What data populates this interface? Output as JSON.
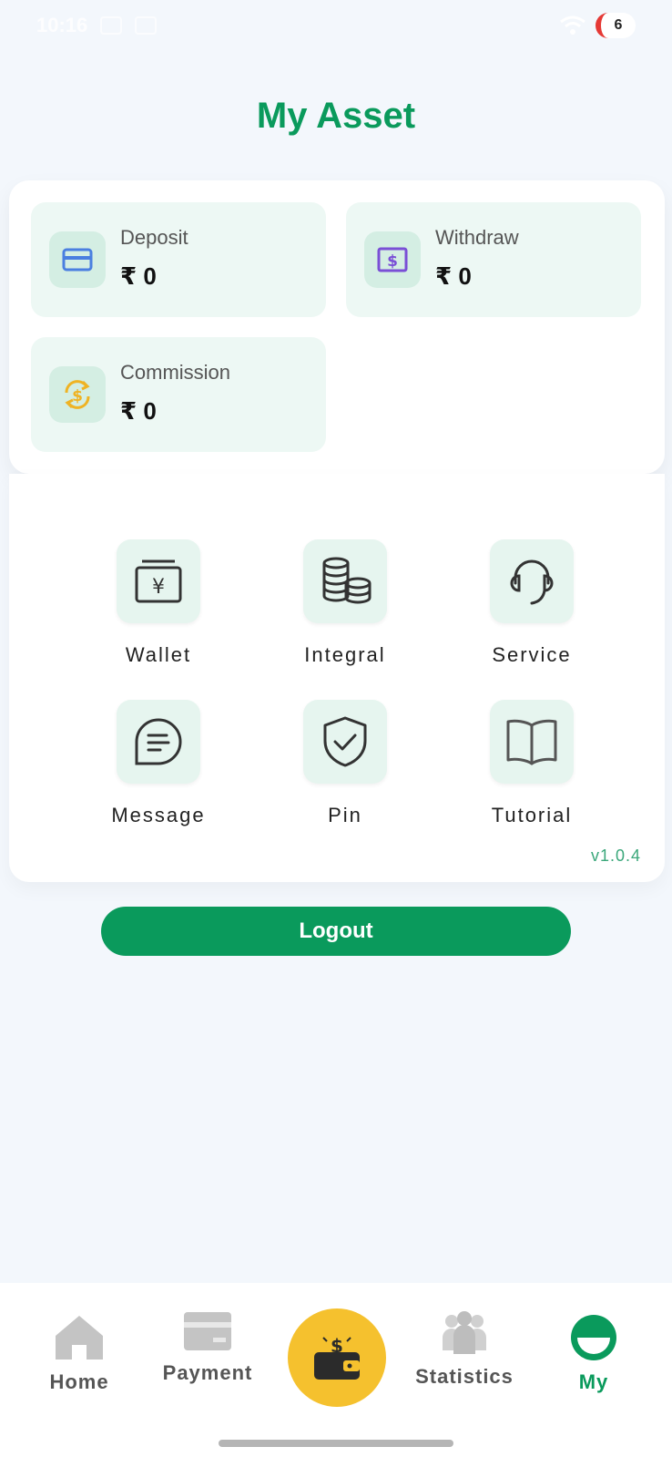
{
  "status_bar": {
    "time": "10:16",
    "battery": "6"
  },
  "page": {
    "title": "My Asset"
  },
  "stats": [
    {
      "label": "Deposit",
      "value": "₹ 0",
      "icon": "card-icon"
    },
    {
      "label": "Withdraw",
      "value": "₹ 0",
      "icon": "dollar-bill-icon"
    },
    {
      "label": "Commission",
      "value": "₹ 0",
      "icon": "dollar-exchange-icon"
    }
  ],
  "menu": [
    {
      "label": "Wallet",
      "icon": "wallet-icon"
    },
    {
      "label": "Integral",
      "icon": "coins-icon"
    },
    {
      "label": "Service",
      "icon": "headset-icon"
    },
    {
      "label": "Message",
      "icon": "chat-bubble-icon"
    },
    {
      "label": "Pin",
      "icon": "shield-check-icon"
    },
    {
      "label": "Tutorial",
      "icon": "book-icon"
    }
  ],
  "version": "v1.0.4",
  "logout_label": "Logout",
  "nav": [
    {
      "label": "Home",
      "icon": "home-icon"
    },
    {
      "label": "Payment",
      "icon": "payment-card-icon"
    },
    {
      "label": "",
      "icon": "wallet-money-icon"
    },
    {
      "label": "Statistics",
      "icon": "people-icon"
    },
    {
      "label": "My",
      "icon": "user-icon",
      "active": true
    }
  ],
  "colors": {
    "brand": "#0a9a5c",
    "accent": "#f5c12e",
    "background": "#f3f7fc"
  }
}
